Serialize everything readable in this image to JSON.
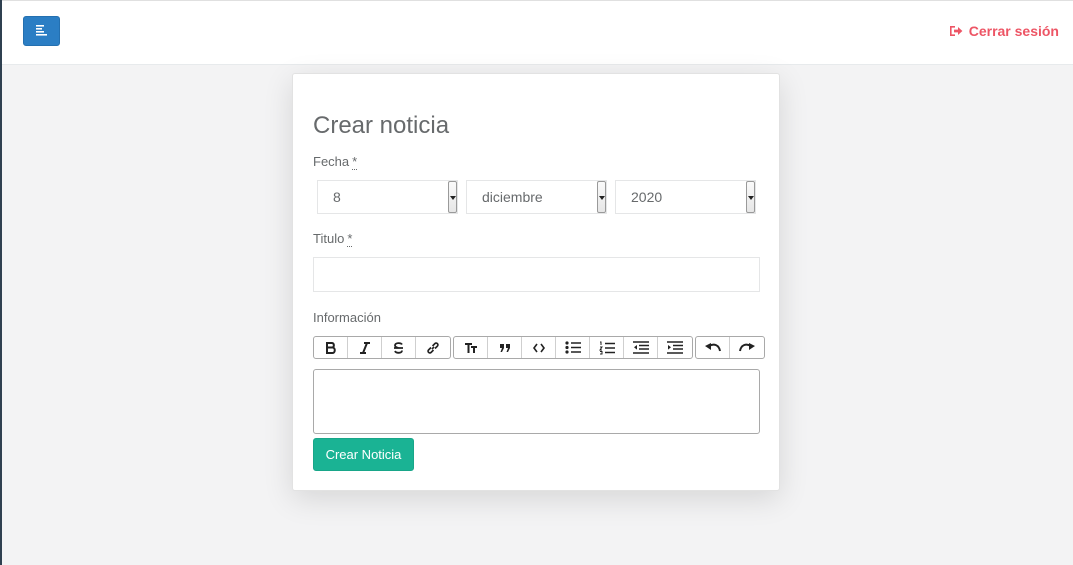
{
  "header": {
    "menu_icon": "align-left-icon",
    "logout_label": "Cerrar sesión",
    "logout_icon": "sign-out-icon",
    "logout_color": "#ed5565"
  },
  "form": {
    "title": "Crear noticia",
    "fecha_label": "Fecha",
    "required_mark": "*",
    "day": "8",
    "month": "diciembre",
    "year": "2020",
    "titulo_label": "Titulo",
    "titulo_value": "",
    "informacion_label": "Información",
    "informacion_value": "",
    "submit_label": "Crear Noticia",
    "submit_color": "#1ab394"
  },
  "toolbar": {
    "groups": [
      [
        "bold-icon",
        "italic-icon",
        "strikethrough-icon",
        "link-icon"
      ],
      [
        "heading-icon",
        "quote-icon",
        "code-icon",
        "bullet-list-icon",
        "numbered-list-icon",
        "outdent-icon",
        "indent-icon"
      ],
      [
        "undo-icon",
        "redo-icon"
      ]
    ]
  },
  "colors": {
    "primary": "#2b7ec4",
    "background": "#f3f3f4"
  }
}
